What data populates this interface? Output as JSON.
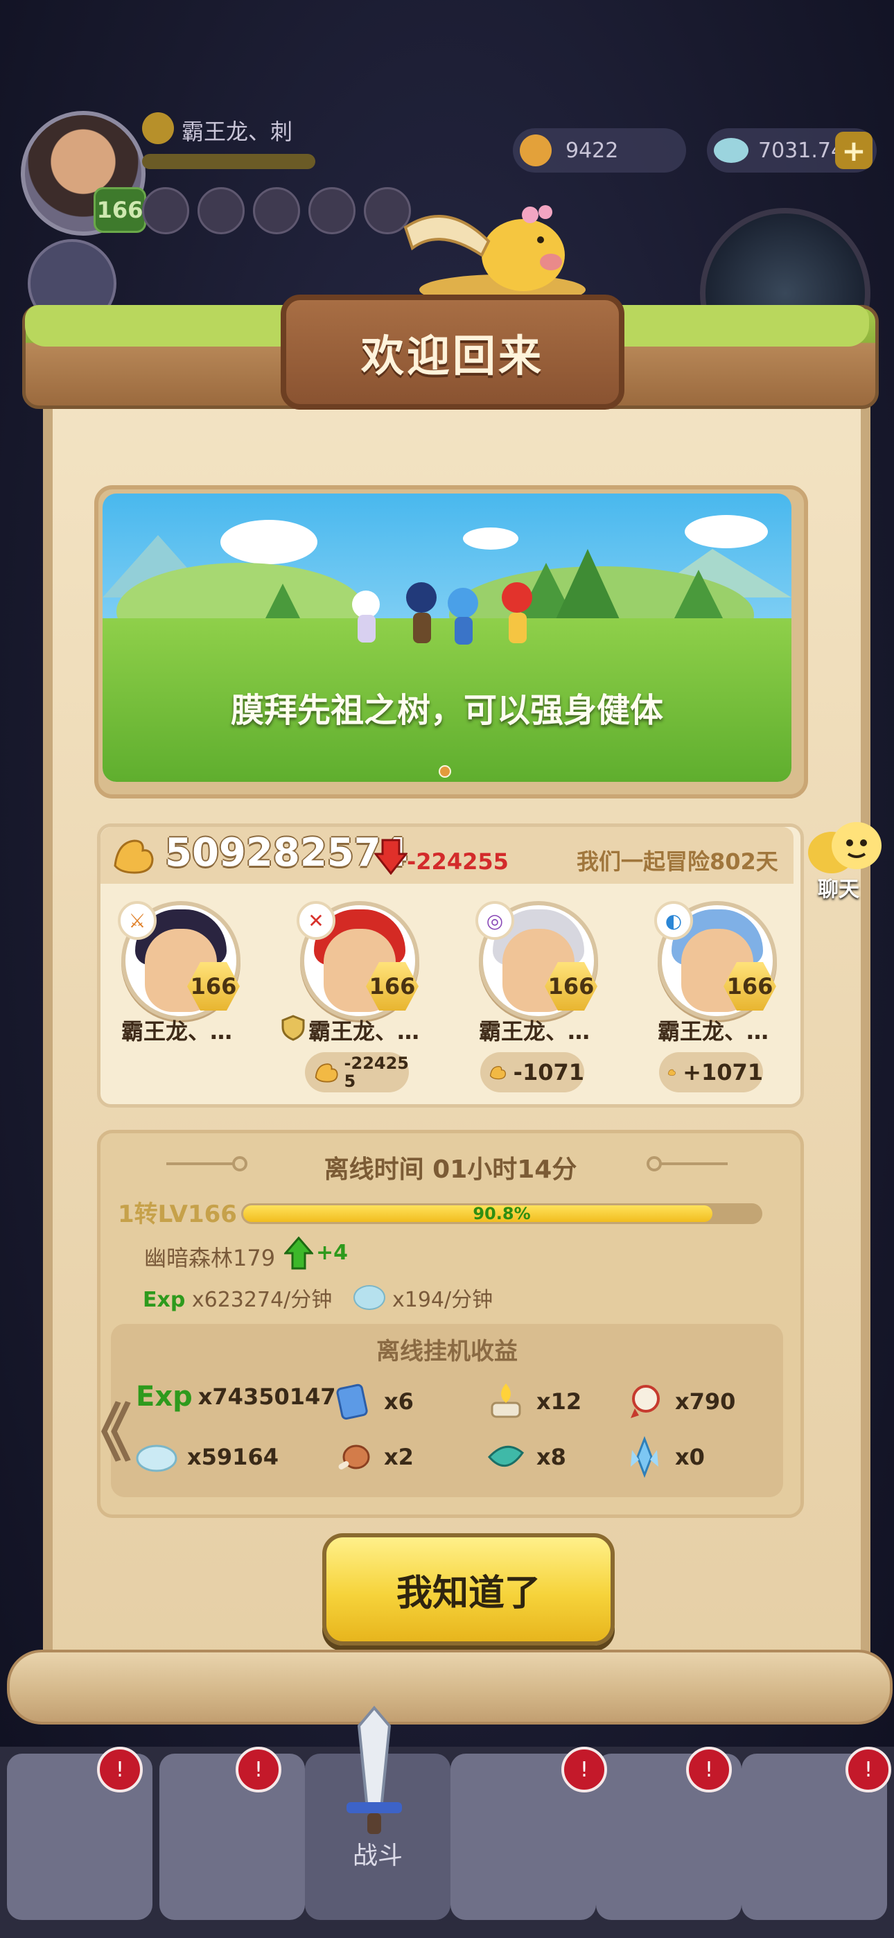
{
  "hud": {
    "player_level": "166",
    "player_name": "霸王龙、刺",
    "coins": "9422",
    "gems": "7031.74M",
    "add_label": "+"
  },
  "dialog": {
    "title": "欢迎回来",
    "banner_caption": "膜拜先祖之树，可以强身健体",
    "power_value": "509282574",
    "power_change": "-224255",
    "adventure_days": "我们一起冒险802天",
    "heroes": [
      {
        "name": "霸王龙、…",
        "level": "166",
        "power_change": ""
      },
      {
        "name": "霸王龙、…",
        "level": "166",
        "power_change_line1": "-22425",
        "power_change_line2": "5"
      },
      {
        "name": "霸王龙、…",
        "level": "166",
        "power_change": "-1071"
      },
      {
        "name": "霸王龙、…",
        "level": "166",
        "power_change": "+1071"
      }
    ],
    "offline_time": "离线时间 01小时14分",
    "rebirth_level": "1转LV166",
    "xp_percent": "90.8%",
    "xp_fraction": 0.908,
    "zone": "幽暗森林179",
    "zone_delta": "+4",
    "exp_tag": "Exp",
    "exp_rate": "x623274/分钟",
    "gem_rate": "x194/分钟",
    "rewards_title": "离线挂机收益",
    "rewards": [
      {
        "icon": "exp-icon",
        "label": "Exp",
        "count": "x74350147"
      },
      {
        "icon": "scroll-card-icon",
        "count": "x6"
      },
      {
        "icon": "flame-altar-icon",
        "count": "x12"
      },
      {
        "icon": "medal-icon",
        "count": "x790"
      },
      {
        "icon": "gem-icon",
        "count": "x59164"
      },
      {
        "icon": "meat-icon",
        "count": "x2"
      },
      {
        "icon": "crystal-leaf-icon",
        "count": "x8"
      },
      {
        "icon": "ice-crystal-icon",
        "count": "x0"
      }
    ],
    "confirm_label": "我知道了",
    "prev_chevron": "《"
  },
  "chat_label": "聊天",
  "nav": {
    "battle_label": "战斗",
    "bell": "!"
  },
  "colors": {
    "accent_gold": "#f6d33b",
    "negative": "#d32b2b",
    "positive": "#2e9a1d",
    "parchment": "#f3e3c3"
  }
}
